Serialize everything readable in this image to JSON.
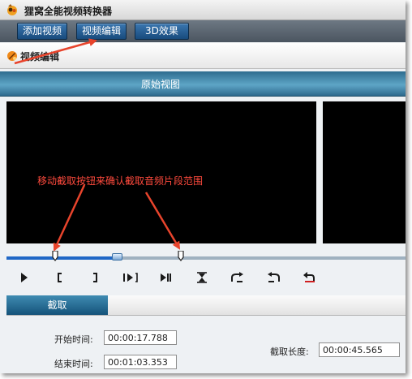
{
  "window": {
    "title": "狸窝全能视频转换器"
  },
  "toolbar": {
    "add_video": "添加视频",
    "edit_video": "视频编辑",
    "effect_3d": "3D效果"
  },
  "header": {
    "title": "视频编辑"
  },
  "preview": {
    "section_title": "原始视图",
    "annotation": "移动截取按钮来确认截取音频片段范围"
  },
  "timeline": {
    "progress": 0.27
  },
  "controls": [
    "play-icon",
    "mark-start-icon",
    "mark-end-icon",
    "go-to-start-icon",
    "go-to-end-icon",
    "center-split-icon",
    "forward-step-icon",
    "backward-step-icon",
    "undo-icon"
  ],
  "tabs": {
    "clip": "截取"
  },
  "clip": {
    "start_label": "开始时间:",
    "start_value": "00:00:17.788",
    "end_label": "结束时间:",
    "end_value": "00:01:03.353",
    "length_label": "截取长度:",
    "length_value": "00:00:45.565"
  },
  "colors": {
    "accent": "#1f67c6",
    "annotation": "#ff4a3d",
    "section_bar": "#3f8bb2"
  }
}
